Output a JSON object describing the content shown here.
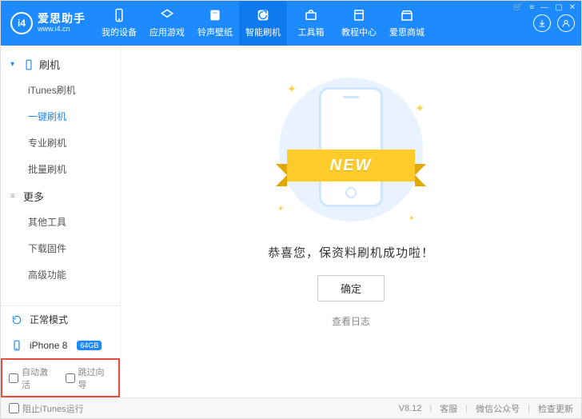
{
  "header": {
    "logo_badge": "i4",
    "logo_title": "爱思助手",
    "logo_sub": "www.i4.cn",
    "nav": [
      {
        "label": "我的设备",
        "icon": "phone"
      },
      {
        "label": "应用游戏",
        "icon": "apps"
      },
      {
        "label": "铃声壁纸",
        "icon": "music"
      },
      {
        "label": "智能刷机",
        "icon": "flash",
        "active": true
      },
      {
        "label": "工具箱",
        "icon": "toolbox"
      },
      {
        "label": "教程中心",
        "icon": "book"
      },
      {
        "label": "爱思商城",
        "icon": "store"
      }
    ]
  },
  "sidebar": {
    "group1_title": "刷机",
    "group1_items": [
      "iTunes刷机",
      "一键刷机",
      "专业刷机",
      "批量刷机"
    ],
    "group1_active_index": 1,
    "group2_title": "更多",
    "group2_items": [
      "其他工具",
      "下载固件",
      "高级功能"
    ],
    "status_mode": "正常模式",
    "device_name": "iPhone 8",
    "device_storage": "64GB",
    "cb_auto_activate": "自动激活",
    "cb_skip_guide": "跳过向导"
  },
  "main": {
    "ribbon_text": "NEW",
    "success_msg": "恭喜您，保资料刷机成功啦！",
    "confirm_label": "确定",
    "log_label": "查看日志"
  },
  "footer": {
    "block_itunes": "阻止iTunes运行",
    "version": "V8.12",
    "support": "客服",
    "wechat": "微信公众号",
    "update": "检查更新"
  }
}
